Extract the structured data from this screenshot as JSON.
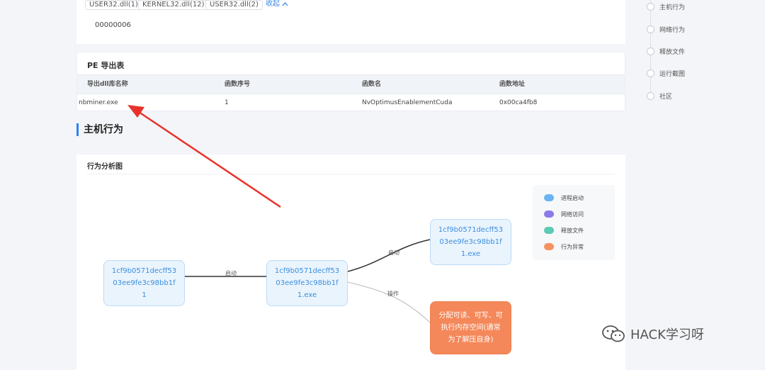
{
  "imports": {
    "tags": [
      "USER32.dll(1)",
      "KERNEL32.dll(12)",
      "USER32.dll(2)"
    ],
    "collapse_label": "收起",
    "collapse_icon": "chevron-up-icon",
    "count": "00000006"
  },
  "pe_export": {
    "title": "PE 导出表",
    "columns": [
      "导出dll库名称",
      "函数序号",
      "函数名",
      "函数地址"
    ],
    "rows": [
      [
        "nbminer.exe",
        "1",
        "NvOptimusEnablementCuda",
        "0x00ca4fb8"
      ]
    ]
  },
  "section_title": "主机行为",
  "behavior": {
    "title": "行为分析图",
    "nodes": {
      "parent": "1cf9b0571decff5303ee9fe3c98bb1f1",
      "main": "1cf9b0571decff5303ee9fe3c98bb1f1.exe",
      "child": "1cf9b0571decff5303ee9fe3c98bb1f1.exe",
      "anomaly": "分配可读、可写、可执行内存空间(通常为了解压自身)"
    },
    "edges": {
      "start1": "启动",
      "start2": "启动",
      "operate": "操作"
    },
    "legend": [
      {
        "label": "进程启动",
        "color": "#6cb3f2"
      },
      {
        "label": "网络访问",
        "color": "#8b79e8"
      },
      {
        "label": "释放文件",
        "color": "#5ccab5"
      },
      {
        "label": "行为异常",
        "color": "#f4925f"
      }
    ]
  },
  "toc": [
    "主机行为",
    "网络行为",
    "释放文件",
    "运行截图",
    "社区"
  ],
  "annotation": {
    "color": "#e8322a"
  },
  "watermark": {
    "text": "HACK学习呀",
    "icon": "wechat-icon"
  }
}
